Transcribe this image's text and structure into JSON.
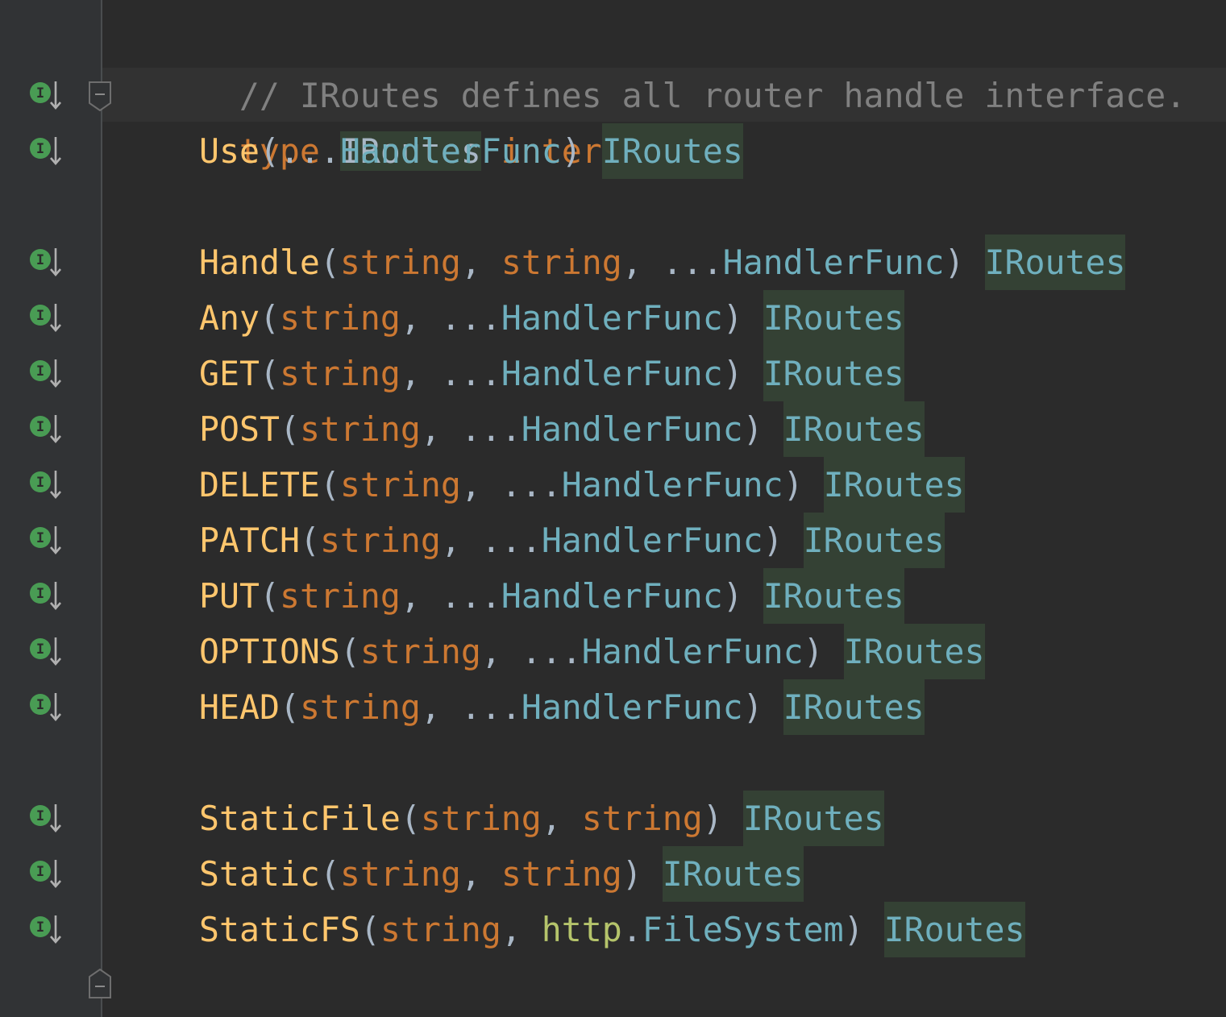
{
  "editor": {
    "comment": "// IRoutes defines all router handle interface.",
    "decl": {
      "keyword_type": "type",
      "name": "IRoutes",
      "keyword_interface": "interface",
      "open_brace": "{"
    },
    "methods": [
      {
        "name": "Use",
        "params": [
          {
            "kind": "dots",
            "text": "..."
          },
          {
            "kind": "type",
            "text": "HandlerFunc"
          }
        ],
        "ret": "IRoutes"
      },
      {
        "name": "Handle",
        "params": [
          {
            "kind": "prm",
            "text": "string"
          },
          {
            "kind": "sep",
            "text": ", "
          },
          {
            "kind": "prm",
            "text": "string"
          },
          {
            "kind": "sep",
            "text": ", "
          },
          {
            "kind": "dots",
            "text": "..."
          },
          {
            "kind": "type",
            "text": "HandlerFunc"
          }
        ],
        "ret": "IRoutes"
      },
      {
        "name": "Any",
        "params": [
          {
            "kind": "prm",
            "text": "string"
          },
          {
            "kind": "sep",
            "text": ", "
          },
          {
            "kind": "dots",
            "text": "..."
          },
          {
            "kind": "type",
            "text": "HandlerFunc"
          }
        ],
        "ret": "IRoutes"
      },
      {
        "name": "GET",
        "params": [
          {
            "kind": "prm",
            "text": "string"
          },
          {
            "kind": "sep",
            "text": ", "
          },
          {
            "kind": "dots",
            "text": "..."
          },
          {
            "kind": "type",
            "text": "HandlerFunc"
          }
        ],
        "ret": "IRoutes"
      },
      {
        "name": "POST",
        "params": [
          {
            "kind": "prm",
            "text": "string"
          },
          {
            "kind": "sep",
            "text": ", "
          },
          {
            "kind": "dots",
            "text": "..."
          },
          {
            "kind": "type",
            "text": "HandlerFunc"
          }
        ],
        "ret": "IRoutes"
      },
      {
        "name": "DELETE",
        "params": [
          {
            "kind": "prm",
            "text": "string"
          },
          {
            "kind": "sep",
            "text": ", "
          },
          {
            "kind": "dots",
            "text": "..."
          },
          {
            "kind": "type",
            "text": "HandlerFunc"
          }
        ],
        "ret": "IRoutes"
      },
      {
        "name": "PATCH",
        "params": [
          {
            "kind": "prm",
            "text": "string"
          },
          {
            "kind": "sep",
            "text": ", "
          },
          {
            "kind": "dots",
            "text": "..."
          },
          {
            "kind": "type",
            "text": "HandlerFunc"
          }
        ],
        "ret": "IRoutes"
      },
      {
        "name": "PUT",
        "params": [
          {
            "kind": "prm",
            "text": "string"
          },
          {
            "kind": "sep",
            "text": ", "
          },
          {
            "kind": "dots",
            "text": "..."
          },
          {
            "kind": "type",
            "text": "HandlerFunc"
          }
        ],
        "ret": "IRoutes"
      },
      {
        "name": "OPTIONS",
        "params": [
          {
            "kind": "prm",
            "text": "string"
          },
          {
            "kind": "sep",
            "text": ", "
          },
          {
            "kind": "dots",
            "text": "..."
          },
          {
            "kind": "type",
            "text": "HandlerFunc"
          }
        ],
        "ret": "IRoutes"
      },
      {
        "name": "HEAD",
        "params": [
          {
            "kind": "prm",
            "text": "string"
          },
          {
            "kind": "sep",
            "text": ", "
          },
          {
            "kind": "dots",
            "text": "..."
          },
          {
            "kind": "type",
            "text": "HandlerFunc"
          }
        ],
        "ret": "IRoutes"
      },
      {
        "name": "StaticFile",
        "params": [
          {
            "kind": "prm",
            "text": "string"
          },
          {
            "kind": "sep",
            "text": ", "
          },
          {
            "kind": "prm",
            "text": "string"
          }
        ],
        "ret": "IRoutes"
      },
      {
        "name": "Static",
        "params": [
          {
            "kind": "prm",
            "text": "string"
          },
          {
            "kind": "sep",
            "text": ", "
          },
          {
            "kind": "prm",
            "text": "string"
          }
        ],
        "ret": "IRoutes"
      },
      {
        "name": "StaticFS",
        "params": [
          {
            "kind": "prm",
            "text": "string"
          },
          {
            "kind": "sep",
            "text": ", "
          },
          {
            "kind": "pkg",
            "text": "http"
          },
          {
            "kind": "pun",
            "text": "."
          },
          {
            "kind": "type",
            "text": "FileSystem"
          }
        ],
        "ret": "IRoutes"
      }
    ],
    "close_brace": "}",
    "gutter_icon": "implemented-interface-icon",
    "gutter_icon_letter": "I",
    "colors": {
      "background": "#2b2b2b",
      "gutter": "#313335",
      "keyword": "#cc7832",
      "function": "#ffc66d",
      "type": "#6fafbd",
      "comment": "#808080",
      "punctuation": "#a9b7c6",
      "package": "#b5c46b",
      "usage_highlight": "#344134",
      "icon_green": "#499c54"
    }
  }
}
